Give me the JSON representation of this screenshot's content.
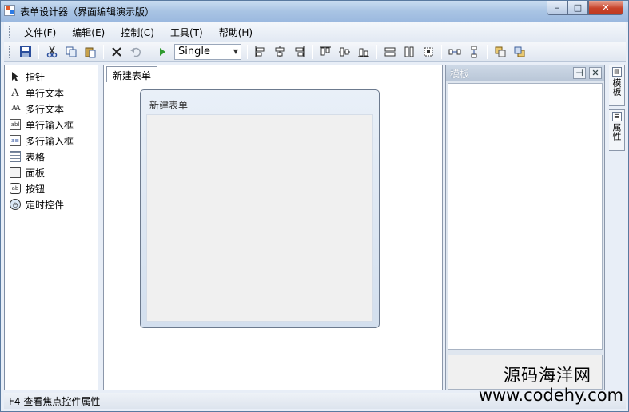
{
  "window": {
    "title": "表单设计器（界面编辑演示版）",
    "buttons": {
      "minimize": "–",
      "maximize": "□",
      "close": "✕"
    }
  },
  "menubar": {
    "items": [
      "文件(F)",
      "编辑(E)",
      "控制(C)",
      "工具(T)",
      "帮助(H)"
    ]
  },
  "toolbar": {
    "icons": [
      "save-icon",
      "cut-icon",
      "copy-icon",
      "paste-icon",
      "delete-icon",
      "undo-icon",
      "run-icon",
      "align-left-icon",
      "align-center-icon",
      "align-right-icon",
      "align-top-icon",
      "align-middle-icon",
      "align-bottom-icon",
      "same-width-icon",
      "same-height-icon",
      "same-size-icon",
      "horizontal-spacing-icon",
      "vertical-spacing-icon",
      "bring-to-front-icon",
      "send-to-back-icon"
    ],
    "mode_select": {
      "value": "Single"
    }
  },
  "toolbox": {
    "items": [
      {
        "label": "指针",
        "icon": "pointer-icon",
        "glyph": "➤"
      },
      {
        "label": "单行文本",
        "icon": "label-icon",
        "glyph": "A"
      },
      {
        "label": "多行文本",
        "icon": "multiline-label-icon",
        "glyph": "AA"
      },
      {
        "label": "单行输入框",
        "icon": "textbox-icon",
        "glyph": "abl"
      },
      {
        "label": "多行输入框",
        "icon": "multiline-textbox-icon",
        "glyph": "a≡"
      },
      {
        "label": "表格",
        "icon": "table-icon",
        "glyph": ""
      },
      {
        "label": "面板",
        "icon": "panel-icon",
        "glyph": ""
      },
      {
        "label": "按钮",
        "icon": "button-icon",
        "glyph": "ab"
      },
      {
        "label": "定时控件",
        "icon": "timer-icon",
        "glyph": "◷"
      }
    ]
  },
  "document": {
    "tab_label": "新建表单",
    "form_title": "新建表单"
  },
  "template_panel": {
    "title": "模板",
    "pin": "⊣",
    "close": "✕"
  },
  "side_tabs": [
    {
      "label": "模板",
      "icon": "template-icon"
    },
    {
      "label": "属性",
      "icon": "properties-icon"
    }
  ],
  "status": {
    "text": "F4 查看焦点控件属性"
  },
  "watermark": {
    "name": "源码海洋网",
    "url": "www.codehy.com"
  }
}
